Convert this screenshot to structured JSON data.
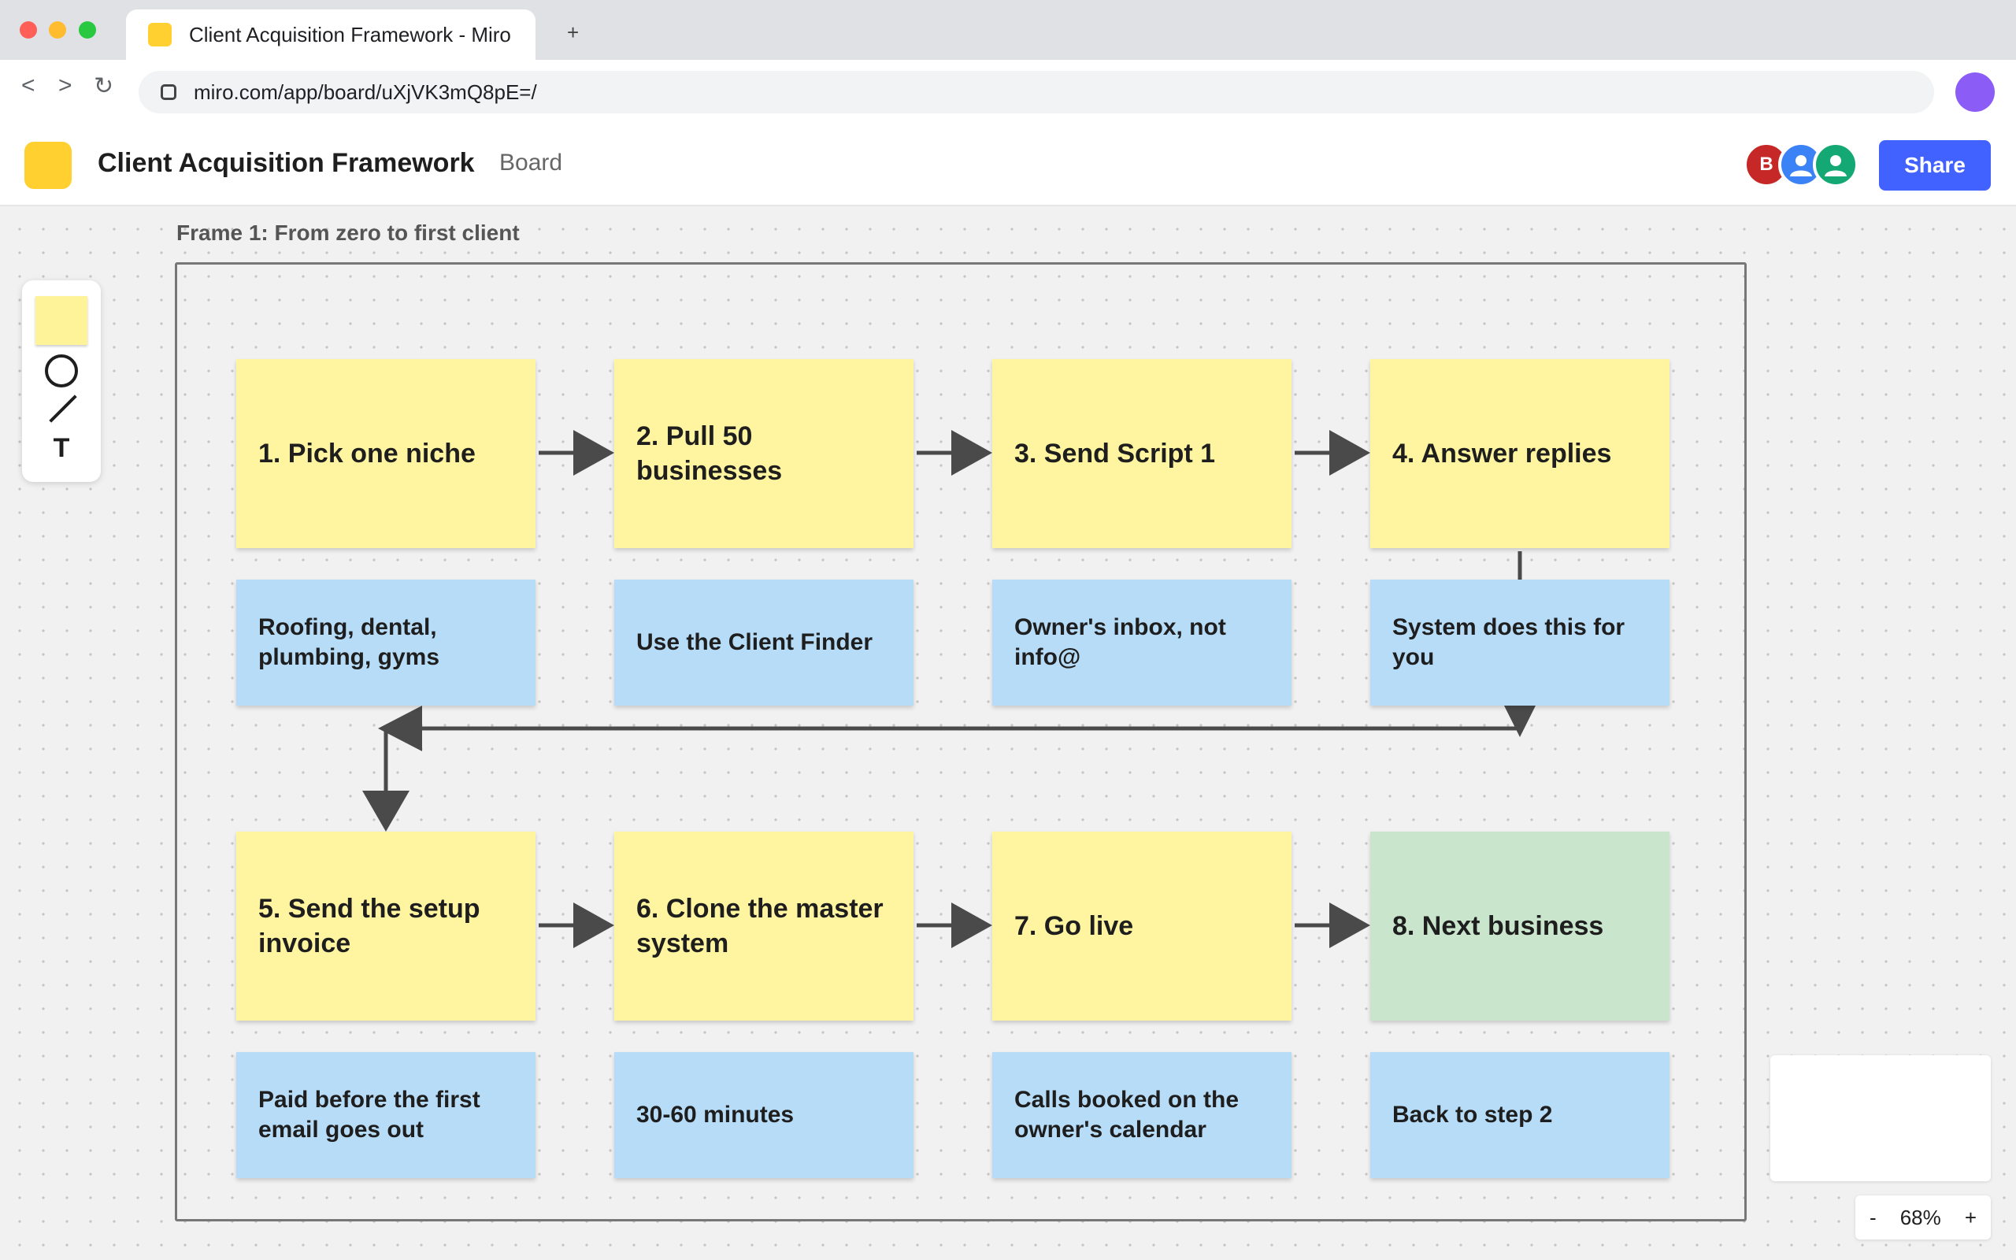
{
  "browser": {
    "tab_title": "Client Acquisition Framework - Miro",
    "new_tab_label": "+",
    "back_label": "<",
    "forward_label": ">",
    "reload_label": "↻",
    "url": "miro.com/app/board/uXjVK3mQ8pE=/"
  },
  "header": {
    "board_title": "Client Acquisition Framework",
    "board_type": "Board",
    "avatars": [
      {
        "initial": "B",
        "color": "#c62828"
      },
      {
        "initial": "",
        "color": "#3b82f6"
      },
      {
        "initial": "",
        "color": "#14a874"
      }
    ],
    "share_label": "Share",
    "brand_color": "#4262ff"
  },
  "toolbar": {
    "tools": [
      "sticky-note-icon",
      "circle-shape-icon",
      "line-icon",
      "text-tool-icon"
    ],
    "text_tool_label": "T"
  },
  "frame": {
    "title": "Frame 1: From zero to first client"
  },
  "steps": [
    {
      "label": "1. Pick one niche",
      "note": "Roofing, dental, plumbing, gyms"
    },
    {
      "label": "2. Pull 50 businesses",
      "note": "Use the Client Finder"
    },
    {
      "label": "3. Send Script 1",
      "note": "Owner's inbox, not info@"
    },
    {
      "label": "4. Answer replies",
      "note": "System does this for you"
    },
    {
      "label": "5. Send the setup invoice",
      "note": "Paid before the first email goes out"
    },
    {
      "label": "6. Clone the master system",
      "note": "30-60 minutes"
    },
    {
      "label": "7. Go live",
      "note": "Calls booked on the owner's calendar"
    },
    {
      "label": "8. Next business",
      "note": "Back to step 2"
    }
  ],
  "colors": {
    "step_sticky": "#fff49f",
    "final_step_sticky": "#c9e5cc",
    "note_sticky": "#b7dcf8",
    "connector": "#4a4a4a"
  },
  "zoom": {
    "minus_label": "-",
    "level": "68%",
    "plus_label": "+"
  }
}
